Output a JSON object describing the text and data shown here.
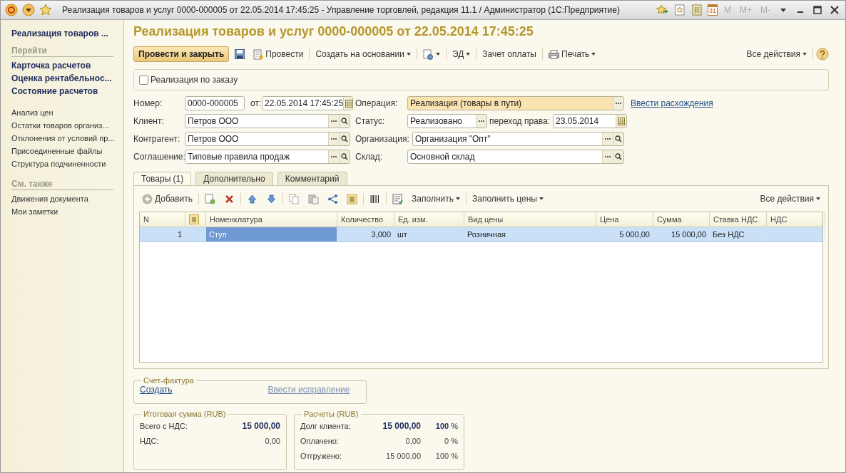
{
  "window": {
    "title": "Реализация товаров и услуг 0000-000005 от 22.05.2014 17:45:25 - Управление торговлей, редакция 11.1 / Администратор  (1С:Предприятие)",
    "calendar_day": "31",
    "memory_buttons": [
      "M",
      "M+",
      "M-"
    ]
  },
  "sidebar": {
    "title": "Реализация товаров ...",
    "groups": [
      {
        "heading": "Перейти",
        "kind": "primary",
        "items": [
          "Карточка расчетов",
          "Оценка рентабельнос...",
          "Состояние расчетов"
        ]
      },
      {
        "kind": "secondary",
        "items": [
          "Анализ цен",
          "Остатки товаров организ...",
          "Отклонения от условий пр...",
          "Присоединенные файлы",
          "Структура подчиненности"
        ]
      },
      {
        "heading": "См. также",
        "kind": "secondary",
        "items": [
          "Движения документа",
          "Мои заметки"
        ]
      }
    ]
  },
  "form": {
    "title": "Реализация товаров и услуг 0000-000005 от 22.05.2014 17:45:25",
    "toolbar": {
      "default_button": "Провести и закрыть",
      "items": [
        {
          "kind": "save"
        },
        {
          "kind": "post",
          "label": "Провести"
        },
        {
          "kind": "menu",
          "label": "Создать на основании"
        },
        {
          "kind": "icon-menu"
        },
        {
          "kind": "menu",
          "label": "ЭД"
        },
        {
          "kind": "plain",
          "label": "Зачет оплаты"
        },
        {
          "kind": "print",
          "label": "Печать"
        }
      ],
      "all_actions": "Все действия"
    },
    "order_checkbox": {
      "label": "Реализация по заказу",
      "checked": false
    },
    "header": {
      "number": {
        "label": "Номер:",
        "value": "0000-000005"
      },
      "date": {
        "label": "от:",
        "value": "22.05.2014 17:45:25"
      },
      "operation": {
        "label": "Операция:",
        "value": "Реализация (товары в пути)"
      },
      "discrepancy_link": "Ввести расхождения",
      "client": {
        "label": "Клиент:",
        "value": "Петров ООО"
      },
      "status": {
        "label": "Статус:",
        "value": "Реализовано"
      },
      "transfer_date": {
        "label": "переход права:",
        "value": "23.05.2014"
      },
      "counterparty": {
        "label": "Контрагент:",
        "value": "Петров ООО"
      },
      "organization": {
        "label": "Организация:",
        "value": "Организация \"Опт\""
      },
      "agreement": {
        "label": "Соглашение:",
        "value": "Типовые правила продаж"
      },
      "warehouse": {
        "label": "Склад:",
        "value": "Основной склад"
      }
    },
    "tabs": [
      {
        "label": "Товары (1)",
        "selected": true
      },
      {
        "label": "Дополнительно",
        "selected": false
      },
      {
        "label": "Комментарий",
        "selected": false
      }
    ],
    "goods_toolbar": {
      "add": "Добавить",
      "fill": "Заполнить",
      "fill_prices": "Заполнить цены",
      "all_actions": "Все действия"
    },
    "table": {
      "columns": [
        {
          "kind": "text",
          "label": "N"
        },
        {
          "kind": "icon"
        },
        {
          "kind": "text",
          "label": "Номенклатура"
        },
        {
          "kind": "text",
          "label": "Количество"
        },
        {
          "kind": "text",
          "label": "Ед. изм."
        },
        {
          "kind": "text",
          "label": "Вид цены"
        },
        {
          "kind": "text",
          "label": "Цена"
        },
        {
          "kind": "text",
          "label": "Сумма"
        },
        {
          "kind": "text",
          "label": "Ставка НДС"
        },
        {
          "kind": "text",
          "label": "НДС"
        }
      ],
      "rows": [
        {
          "selected": true,
          "cells": [
            {
              "text": "1",
              "current": false
            },
            {
              "text": "",
              "current": false
            },
            {
              "text": "Стул",
              "current": true
            },
            {
              "text": "3,000",
              "current": false
            },
            {
              "text": "шт",
              "current": false
            },
            {
              "text": "Розничная",
              "current": false
            },
            {
              "text": "5 000,00",
              "current": false
            },
            {
              "text": "15 000,00",
              "current": false
            },
            {
              "text": "Без НДС",
              "current": false
            },
            {
              "text": "",
              "current": false
            }
          ]
        }
      ]
    },
    "invoice": {
      "legend": "Счет-фактура",
      "create_link": {
        "label": "Создать",
        "disabled": false
      },
      "correction_link": {
        "label": "Ввести исправление",
        "disabled": true
      }
    },
    "totals": {
      "legend": "Итоговая сумма (RUB)",
      "rows": [
        {
          "label": "Всего с НДС:",
          "value": "15 000,00",
          "bold": true
        },
        {
          "label": "НДС:",
          "value": "0,00",
          "bold": false
        }
      ]
    },
    "settlements": {
      "legend": "Расчеты (RUB)",
      "rows": [
        {
          "label": "Долг клиента:",
          "value": "15 000,00",
          "percent": "**100** %",
          "bold": true
        },
        {
          "label": "Оплачено:",
          "value": "0,00",
          "percent": "0 %",
          "bold": false
        },
        {
          "label": "Отгружено:",
          "value": "15 000,00",
          "percent": "100 %",
          "bold": false
        }
      ]
    }
  }
}
